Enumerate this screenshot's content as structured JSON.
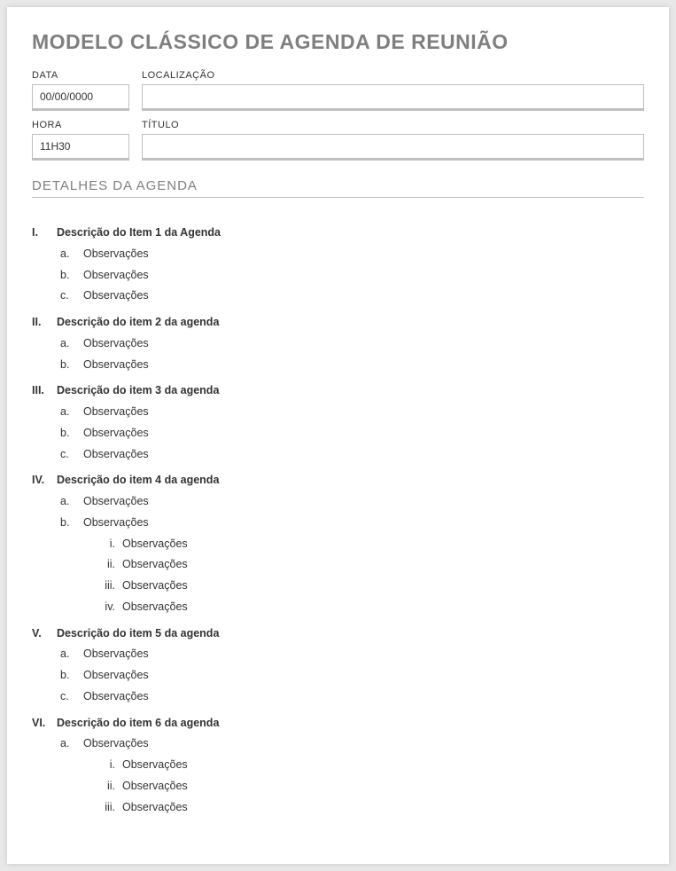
{
  "title": "MODELO CLÁSSICO DE AGENDA DE REUNIÃO",
  "labels": {
    "date": "DATA",
    "location": "LOCALIZAÇÃO",
    "time": "HORA",
    "meeting_title": "TÍTULO"
  },
  "values": {
    "date": "00/00/0000",
    "location": "",
    "time": "11H30",
    "meeting_title": ""
  },
  "section_heading": "DETALHES DA AGENDA",
  "items": [
    {
      "marker": "I.",
      "title": "Descrição do Item 1 da Agenda",
      "subs": [
        {
          "marker": "a.",
          "text": "Observações"
        },
        {
          "marker": "b.",
          "text": "Observações"
        },
        {
          "marker": "c.",
          "text": "Observações"
        }
      ]
    },
    {
      "marker": "II.",
      "title": "Descrição do item 2 da agenda",
      "subs": [
        {
          "marker": "a.",
          "text": "Observações"
        },
        {
          "marker": "b.",
          "text": "Observações"
        }
      ]
    },
    {
      "marker": "III.",
      "title": "Descrição do item 3 da agenda",
      "subs": [
        {
          "marker": "a.",
          "text": "Observações"
        },
        {
          "marker": "b.",
          "text": "Observações"
        },
        {
          "marker": "c.",
          "text": "Observações"
        }
      ]
    },
    {
      "marker": "IV.",
      "title": "Descrição do item 4 da agenda",
      "subs": [
        {
          "marker": "a.",
          "text": "Observações"
        },
        {
          "marker": "b.",
          "text": "Observações",
          "subsubs": [
            {
              "marker": "i.",
              "text": "Observações"
            },
            {
              "marker": "ii.",
              "text": "Observações"
            },
            {
              "marker": "iii.",
              "text": "Observações"
            },
            {
              "marker": "iv.",
              "text": "Observações"
            }
          ]
        }
      ]
    },
    {
      "marker": "V.",
      "title": "Descrição do item 5 da agenda",
      "subs": [
        {
          "marker": "a.",
          "text": "Observações"
        },
        {
          "marker": "b.",
          "text": "Observações"
        },
        {
          "marker": "c.",
          "text": "Observações"
        }
      ]
    },
    {
      "marker": "VI.",
      "title": "Descrição do item 6 da agenda",
      "subs": [
        {
          "marker": "a.",
          "text": "Observações",
          "subsubs": [
            {
              "marker": "i.",
              "text": "Observações"
            },
            {
              "marker": "ii.",
              "text": "Observações"
            },
            {
              "marker": "iii.",
              "text": "Observações"
            }
          ]
        }
      ]
    }
  ]
}
